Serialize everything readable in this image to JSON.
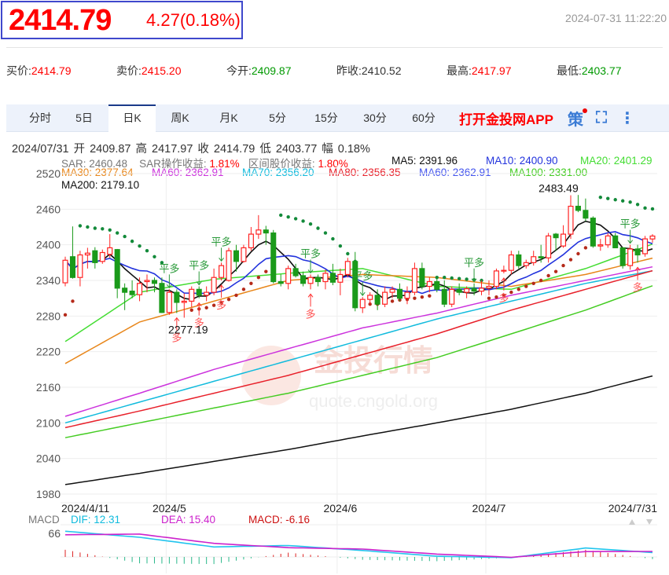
{
  "header": {
    "price": "2414.79",
    "change": "4.27(0.18%)",
    "timestamp": "2024-07-31 11:22:20"
  },
  "quotes": [
    {
      "label": "买价:",
      "value": "2414.79",
      "color": "#f00"
    },
    {
      "label": "卖价:",
      "value": "2415.20",
      "color": "#f00"
    },
    {
      "label": "今开:",
      "value": "2409.87",
      "color": "#090"
    },
    {
      "label": "昨收:",
      "value": "2410.52",
      "color": "#333"
    },
    {
      "label": "最高:",
      "value": "2417.97",
      "color": "#f00"
    },
    {
      "label": "最低:",
      "value": "2403.77",
      "color": "#090"
    }
  ],
  "tabs": [
    "分时",
    "5日",
    "日K",
    "周K",
    "月K",
    "5分",
    "15分",
    "30分",
    "60分"
  ],
  "active_tab": "日K",
  "app_link": "打开金投网APP",
  "strategy_label": "策",
  "info": {
    "date": "2024/07/31",
    "open_label": "开",
    "open": "2409.87",
    "high_label": "高",
    "high": "2417.97",
    "close_label": "收",
    "close": "2414.79",
    "low_label": "低",
    "low": "2403.77",
    "amp_label": "幅",
    "amp": "0.18%"
  },
  "legend": {
    "sar": "SAR: 2460.48",
    "sar_profit_label": "SAR操作收益:",
    "sar_profit": "1.81%",
    "range_label": "区间股价收益:",
    "range": "1.80%",
    "ma": [
      {
        "text": "MA5: 2391.96",
        "color": "#111111"
      },
      {
        "text": "MA10: 2400.90",
        "color": "#2233dd"
      },
      {
        "text": "MA20: 2401.29",
        "color": "#44dd33"
      },
      {
        "text": "MA30: 2377.64",
        "color": "#e8861a"
      },
      {
        "text": "MA60: 2362.91",
        "color": "#cc33dd"
      },
      {
        "text": "MA70: 2356.20",
        "color": "#11bbdd"
      },
      {
        "text": "MA80: 2356.35",
        "color": "#e8202a"
      },
      {
        "text": "MA60: 2362.91",
        "color": "#4455ee"
      },
      {
        "text": "MA100: 2331.00",
        "color": "#44cc22"
      },
      {
        "text": "MA200: 2179.10",
        "color": "#111111"
      }
    ]
  },
  "watermark": {
    "title": "金投行情",
    "url": "quote.cngold.org"
  },
  "chart_data": {
    "type": "candlestick",
    "title": "日K",
    "ylim": [
      1980,
      2520
    ],
    "yticks": [
      2520,
      2460,
      2400,
      2340,
      2280,
      2220,
      2160,
      2100,
      2040,
      1980
    ],
    "xticks": [
      {
        "label": "2024/4/11",
        "index": 0
      },
      {
        "label": "2024/5",
        "index": 14
      },
      {
        "label": "2024/6",
        "index": 37
      },
      {
        "label": "2024/7",
        "index": 57
      },
      {
        "label": "2024/7/31",
        "index": 79
      }
    ],
    "candles": [
      [
        2336,
        2380,
        2330,
        2374
      ],
      [
        2380,
        2431,
        2343,
        2345
      ],
      [
        2345,
        2390,
        2330,
        2383
      ],
      [
        2383,
        2395,
        2360,
        2386
      ],
      [
        2390,
        2396,
        2360,
        2370
      ],
      [
        2372,
        2392,
        2368,
        2387
      ],
      [
        2384,
        2418,
        2378,
        2395
      ],
      [
        2392,
        2393,
        2310,
        2327
      ],
      [
        2327,
        2335,
        2290,
        2320
      ],
      [
        2322,
        2340,
        2310,
        2316
      ],
      [
        2316,
        2345,
        2305,
        2335
      ],
      [
        2338,
        2350,
        2320,
        2340
      ],
      [
        2340,
        2345,
        2320,
        2335
      ],
      [
        2335,
        2345,
        2285,
        2286
      ],
      [
        2286,
        2325,
        2282,
        2320
      ],
      [
        2320,
        2325,
        2285,
        2303
      ],
      [
        2303,
        2318,
        2277.19,
        2305
      ],
      [
        2305,
        2330,
        2295,
        2325
      ],
      [
        2325,
        2330,
        2310,
        2315
      ],
      [
        2315,
        2330,
        2305,
        2320
      ],
      [
        2320,
        2360,
        2315,
        2345
      ],
      [
        2345,
        2370,
        2340,
        2365
      ],
      [
        2340,
        2395,
        2338,
        2390
      ],
      [
        2390,
        2400,
        2355,
        2372
      ],
      [
        2372,
        2400,
        2370,
        2395
      ],
      [
        2395,
        2430,
        2390,
        2418
      ],
      [
        2418,
        2450,
        2410,
        2425
      ],
      [
        2425,
        2432,
        2400,
        2420
      ],
      [
        2420,
        2425,
        2335,
        2338
      ],
      [
        2338,
        2350,
        2330,
        2335
      ],
      [
        2335,
        2365,
        2325,
        2360
      ],
      [
        2360,
        2368,
        2345,
        2348
      ],
      [
        2348,
        2355,
        2330,
        2335
      ],
      [
        2335,
        2350,
        2325,
        2345
      ],
      [
        2345,
        2350,
        2330,
        2338
      ],
      [
        2338,
        2358,
        2325,
        2352
      ],
      [
        2352,
        2368,
        2332,
        2337
      ],
      [
        2337,
        2360,
        2315,
        2350
      ],
      [
        2350,
        2378,
        2345,
        2372
      ],
      [
        2372,
        2388,
        2288,
        2294
      ],
      [
        2294,
        2312,
        2285,
        2308
      ],
      [
        2308,
        2320,
        2300,
        2315
      ],
      [
        2315,
        2325,
        2290,
        2300
      ],
      [
        2300,
        2330,
        2295,
        2320
      ],
      [
        2320,
        2330,
        2310,
        2325
      ],
      [
        2325,
        2335,
        2305,
        2310
      ],
      [
        2310,
        2330,
        2300,
        2320
      ],
      [
        2320,
        2370,
        2315,
        2360
      ],
      [
        2360,
        2370,
        2325,
        2330
      ],
      [
        2330,
        2345,
        2320,
        2338
      ],
      [
        2338,
        2345,
        2320,
        2325
      ],
      [
        2325,
        2340,
        2295,
        2300
      ],
      [
        2300,
        2330,
        2295,
        2325
      ],
      [
        2325,
        2335,
        2315,
        2320
      ],
      [
        2320,
        2330,
        2310,
        2326
      ],
      [
        2326,
        2335,
        2315,
        2322
      ],
      [
        2322,
        2340,
        2315,
        2327
      ],
      [
        2327,
        2340,
        2315,
        2330
      ],
      [
        2330,
        2360,
        2325,
        2356
      ],
      [
        2356,
        2365,
        2352,
        2357
      ],
      [
        2357,
        2390,
        2350,
        2383
      ],
      [
        2383,
        2390,
        2360,
        2365
      ],
      [
        2365,
        2375,
        2360,
        2370
      ],
      [
        2370,
        2390,
        2365,
        2380
      ],
      [
        2380,
        2400,
        2370,
        2378
      ],
      [
        2378,
        2420,
        2370,
        2415
      ],
      [
        2418,
        2420,
        2390,
        2412
      ],
      [
        2398,
        2433,
        2395,
        2418
      ],
      [
        2418,
        2483.49,
        2410,
        2465
      ],
      [
        2465,
        2484,
        2455,
        2458
      ],
      [
        2458,
        2478,
        2440,
        2445
      ],
      [
        2445,
        2448,
        2395,
        2398
      ],
      [
        2398,
        2410,
        2390,
        2400
      ],
      [
        2400,
        2420,
        2395,
        2415
      ],
      [
        2415,
        2420,
        2395,
        2395
      ],
      [
        2395,
        2395,
        2360,
        2365
      ],
      [
        2365,
        2400,
        2358,
        2393
      ],
      [
        2393,
        2400,
        2370,
        2383
      ],
      [
        2385,
        2415,
        2380,
        2410
      ],
      [
        2409.87,
        2417.97,
        2403.77,
        2414.79
      ]
    ],
    "ma_long": {
      "sample_indices": [
        0,
        10,
        20,
        30,
        40,
        50,
        60,
        70,
        79
      ],
      "MA20": [
        2237,
        2320,
        2342,
        2352,
        2360,
        2330,
        2325,
        2360,
        2401.29
      ],
      "MA30": [
        2200,
        2270,
        2305,
        2340,
        2350,
        2345,
        2330,
        2350,
        2377.64
      ],
      "MA60": [
        2111,
        2150,
        2190,
        2225,
        2260,
        2285,
        2315,
        2340,
        2362.91
      ],
      "MA70": [
        2100,
        2135,
        2170,
        2205,
        2240,
        2275,
        2305,
        2335,
        2356.2
      ],
      "MA80": [
        2092,
        2120,
        2150,
        2180,
        2215,
        2250,
        2290,
        2325,
        2356.35
      ],
      "MA100": [
        2075,
        2100,
        2125,
        2150,
        2180,
        2210,
        2250,
        2290,
        2331
      ],
      "MA200": [
        1996,
        2015,
        2035,
        2055,
        2078,
        2100,
        2123,
        2150,
        2179.1
      ]
    },
    "sar": [
      2282,
      2305,
      2432,
      2430,
      2428,
      2427,
      2425,
      2420,
      2414,
      2406,
      2398,
      2390,
      2380,
      2370,
      null,
      null,
      null,
      2290,
      2292,
      2294,
      2298,
      2302,
      2308,
      2315,
      2325,
      2335,
      2345,
      2355,
      null,
      2450,
      2447,
      2444,
      2440,
      2435,
      2428,
      2420,
      2410,
      2398,
      2385,
      2372,
      null,
      2300,
      2300,
      2302,
      2305,
      2307,
      2308,
      2310,
      2312,
      2314,
      2345,
      2345,
      2344,
      2343,
      2342,
      2341,
      2340,
      2310,
      2312,
      2315,
      2320,
      2325,
      2330,
      2335,
      2340,
      2348,
      2355,
      2365,
      2375,
      2385,
      2395,
      null,
      2480,
      2478,
      2476,
      2474,
      2472,
      2468,
      2462,
      2460.48
    ],
    "signals": [
      {
        "index": 14,
        "text": "平多",
        "type": "close"
      },
      {
        "index": 18,
        "text": "平多",
        "type": "close"
      },
      {
        "index": 21,
        "text": "平多",
        "type": "close"
      },
      {
        "index": 33,
        "text": "平多",
        "type": "close"
      },
      {
        "index": 40,
        "text": "平多",
        "type": "close"
      },
      {
        "index": 55,
        "text": "平多",
        "type": "close"
      },
      {
        "index": 76,
        "text": "平多",
        "type": "close"
      },
      {
        "index": 15,
        "text": "多",
        "type": "long"
      },
      {
        "index": 18,
        "text": "多",
        "type": "long"
      },
      {
        "index": 21,
        "text": "多",
        "type": "long"
      },
      {
        "index": 33,
        "text": "多",
        "type": "long"
      },
      {
        "index": 59,
        "text": "多",
        "type": "long"
      },
      {
        "index": 77,
        "text": "多",
        "type": "long"
      }
    ],
    "annotations": [
      {
        "index": 69,
        "value": 2483.49,
        "text": "2483.49"
      },
      {
        "index": 16,
        "value": 2277.19,
        "text": "2277.19"
      }
    ],
    "macd": {
      "label": "MACD",
      "dif_label": "DIF: 12.31",
      "dea_label": "DEA: 15.40",
      "macd_label": "MACD: -6.16",
      "ytick": "66",
      "sample_indices": [
        0,
        10,
        20,
        30,
        40,
        50,
        60,
        70,
        79
      ],
      "dif": [
        72,
        55,
        28,
        32,
        18,
        2,
        -2,
        25,
        12.31
      ],
      "dea": [
        62,
        64,
        38,
        26,
        22,
        8,
        -1,
        15,
        15.4
      ]
    }
  }
}
